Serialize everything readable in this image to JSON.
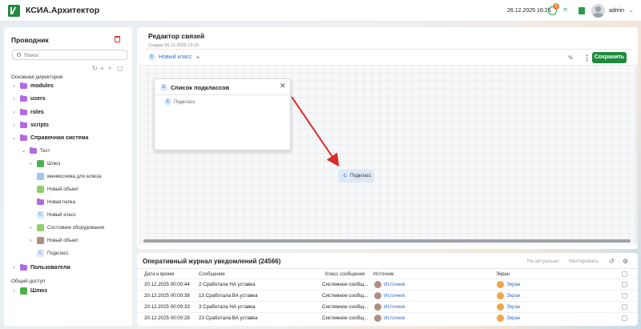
{
  "app": {
    "title": "КСИА.Архитектор"
  },
  "topbar": {
    "datetime": "26.12.2025 16:26",
    "notifications_count": "3",
    "user_name": "admin",
    "user_caret": "⌄"
  },
  "explorer": {
    "title": "Проводник",
    "search_placeholder": "Поиск",
    "section_main": "Основная директория",
    "section_shared": "Общий доступ",
    "tree": [
      {
        "label": "modules",
        "expanded": false
      },
      {
        "label": "users",
        "expanded": false
      },
      {
        "label": "roles",
        "expanded": false
      },
      {
        "label": "scripts",
        "expanded": false
      },
      {
        "label": "Справочная система",
        "expanded": true
      },
      {
        "label": "Тест",
        "expanded": true
      },
      {
        "label": "Шлюз",
        "icon": "gateway-icon",
        "color": "#4caf50"
      },
      {
        "label": "мнемосхема для шлюза",
        "icon": "mnemonic-icon",
        "color": "#9cc8ee"
      },
      {
        "label": "Новый объект",
        "icon": "object-icon",
        "color": "#8fcf6a"
      },
      {
        "label": "Новая папка",
        "icon": "folder-icon",
        "color": "#b26be0"
      },
      {
        "label": "Новый класс",
        "icon": "class-icon",
        "color": "#dbe9fb"
      },
      {
        "label": "Состояние оборудования",
        "icon": "equipment-icon",
        "color": "#8fcf6a"
      },
      {
        "label": "Новый объект",
        "icon": "object-icon",
        "color": "#b08f83"
      },
      {
        "label": "Подкласс",
        "icon": "class-icon",
        "color": "#dbe9fb"
      },
      {
        "label": "Пользователи",
        "expanded": false
      },
      {
        "label": "Шлюз",
        "icon": "gateway-icon",
        "color": "#4caf50"
      }
    ]
  },
  "editor": {
    "title": "Редактор связей",
    "created": "Создан 26.12.2025 13:15",
    "class_chip": "Новый класс",
    "class_badge": "C",
    "save_label": "Сохранить",
    "card_title": "Список подклассов",
    "card_item": "Подкласс",
    "node_label": "Подкласс",
    "arrow_color": "#d92b2b"
  },
  "journal": {
    "title": "Оперативный журнал уведомлений (24566)",
    "btn_irrelevant": "Не актуально",
    "btn_ack": "Квитировать",
    "columns": [
      "Дата и время",
      "Сообщение",
      "Класс сообщения",
      "Источник",
      "Экран"
    ],
    "rows": [
      {
        "datetime": "20.12.2025 00:00:44",
        "message": "2 Сработала НА уставка",
        "class": "Системное сообщ...",
        "source": "Источник",
        "screen": "Экран"
      },
      {
        "datetime": "20.12.2025 00:00:38",
        "message": "13 Сработала ВА уставка",
        "class": "Системное сообщ...",
        "source": "Источник",
        "screen": "Экран"
      },
      {
        "datetime": "20.12.2025 00:00:33",
        "message": "3 Сработала НА уставка",
        "class": "Системное сообщ...",
        "source": "Источник",
        "screen": "Экран"
      },
      {
        "datetime": "20.12.2025 00:00:28",
        "message": "23 Сработала ВА уставка",
        "class": "Системное сообщ...",
        "source": "Источник",
        "screen": "Экран"
      }
    ]
  }
}
